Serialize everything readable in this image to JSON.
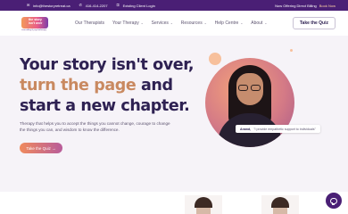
{
  "topbar": {
    "email": "info@thestoryretreat.ca",
    "phone": "416-414-2207",
    "login": "Existing Client Login",
    "announcement": "Now Offering Direct Billing",
    "announcement_link": "Book Now",
    "bg_color": "#4a1f75"
  },
  "logo": {
    "line1": "the story",
    "line2": "isn't over",
    "tagline": "counselling & psychotherapy"
  },
  "nav": {
    "items": [
      {
        "label": "Our Therapists",
        "has_dropdown": false
      },
      {
        "label": "Your Therapy",
        "has_dropdown": true
      },
      {
        "label": "Services",
        "has_dropdown": true
      },
      {
        "label": "Resources",
        "has_dropdown": true
      },
      {
        "label": "Help Centre",
        "has_dropdown": true
      },
      {
        "label": "About",
        "has_dropdown": true
      }
    ],
    "quiz_button": "Take the Quiz"
  },
  "hero": {
    "line1": "Your story isn't over,",
    "line2_accent": "turn the page",
    "line2_rest": " and",
    "line3": "start a new chapter.",
    "subtitle": "Therapy that helps you to accept the things you cannot change, courage to change the things you can, and wisdom to know the difference.",
    "cta_label": "Take the Quiz →",
    "caption_name": "Anand,",
    "caption_quote": "\"I provide empathetic support to individuals\""
  },
  "colors": {
    "heading": "#2e2152",
    "accent": "#c98960",
    "cta_start": "#f08a5d",
    "cta_end": "#b85c9a"
  },
  "icons": {
    "email": "mail-icon",
    "phone": "phone-icon",
    "login": "lock-icon",
    "chat": "chat-bubble-icon"
  }
}
